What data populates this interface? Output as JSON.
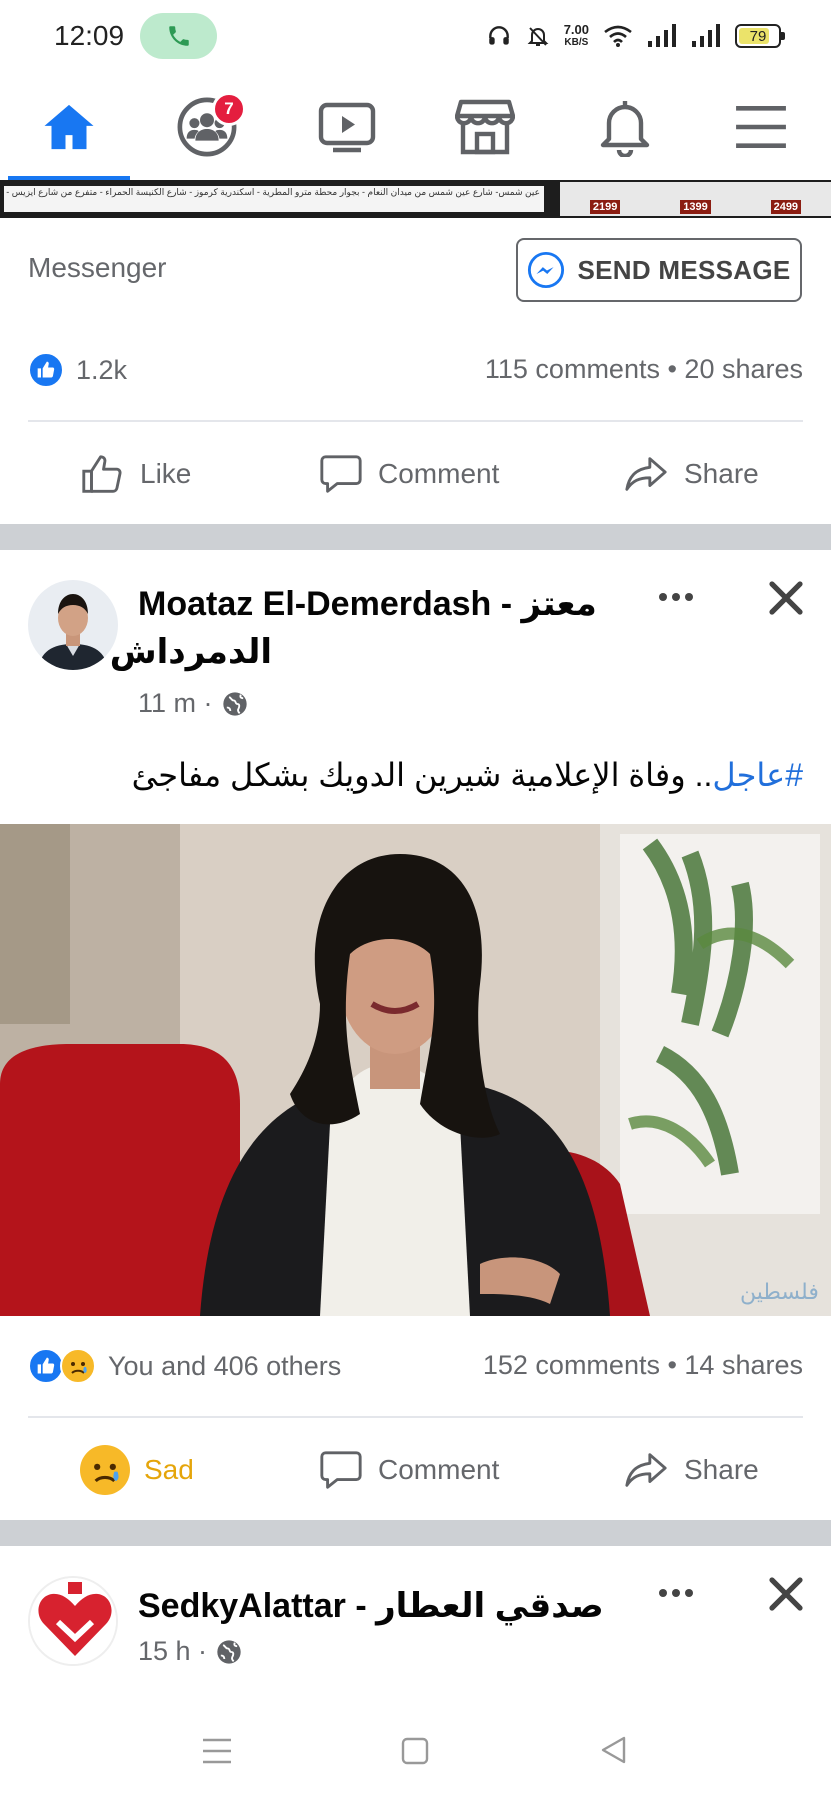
{
  "status_bar": {
    "time": "12:09",
    "net_speed_value": "7.00",
    "net_speed_unit": "KB/S",
    "battery": "79",
    "battery_level_percent": 79
  },
  "nav": {
    "items": [
      {
        "name": "home-icon",
        "active": true
      },
      {
        "name": "groups-icon",
        "badge": "7"
      },
      {
        "name": "watch-icon"
      },
      {
        "name": "marketplace-icon"
      },
      {
        "name": "notifications-icon"
      },
      {
        "name": "menu-icon"
      }
    ],
    "groups_badge": "7"
  },
  "ad_strip": {
    "text": "عين شمس- شارع عين شمس من ميدان النعام - بجوار محطة مترو المطرية - اسكندرية كرموز - شارع الكنيسة الحمراء - متفرع من شارع ايزيس - محطة مصر",
    "prices": [
      "2199",
      "1399",
      "2499"
    ]
  },
  "post1_footer": {
    "messenger_label": "Messenger",
    "send_message_label": "SEND MESSAGE",
    "reaction_count": "1.2k",
    "stats": "115 comments • 20 shares",
    "actions": {
      "like": "Like",
      "comment": "Comment",
      "share": "Share"
    }
  },
  "post2": {
    "author_line1": "Moataz El-Demerdash - معتز",
    "author_line2": "الدمرداش",
    "time": "11 m ·",
    "hashtag": "#عاجل",
    "text_rest": ".. وفاة الإعلامية شيرين الدويك بشكل مفاجئ",
    "image_watermark": "فلسطين",
    "reaction_text": "You and 406 others",
    "stats": "152 comments • 14 shares",
    "actions": {
      "reaction": "Sad",
      "comment": "Comment",
      "share": "Share"
    }
  },
  "post3": {
    "author": "SedkyAlattar - صدقي العطار",
    "time": "15 h ·"
  },
  "colors": {
    "facebook_blue": "#1877f2",
    "badge_red": "#e41e3f",
    "sad_yellow": "#f7b928",
    "sad_label": "#e5a50a",
    "text_secondary": "#65676b",
    "separator": "#cdd0d4"
  }
}
